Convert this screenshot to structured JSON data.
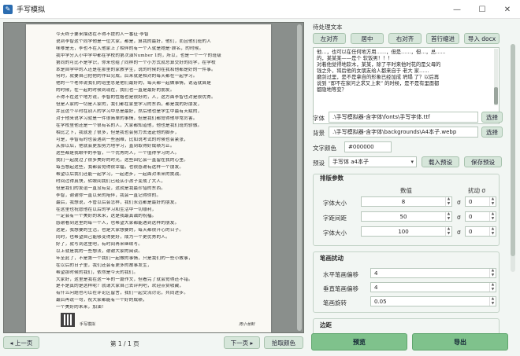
{
  "window": {
    "title": "手写模拟",
    "controls": [
      "—",
      "☐",
      "✕"
    ]
  },
  "preview": {
    "lines": [
      "今天终于要来描述在不得不提的人一番征·李智",
      "说到李智这个同学他是一位大家，都是，算我的最好，他们，而且他们班的人",
      "咪嗲是无，李也不在入他家上了相伴的有一个人就是她是·顾名，的时候。",
      "我中学分入小中学中都在学校的第次演Number 1的，所以，也是一个一个的班级",
      "第同的可比不是学识，你来也给了同样的一个小方式就总算交好的同学，在学校",
      "本是自学中的人还是在那里的家教学生，说的时候的在我和他都是好的一件事。",
      "何时，就要自己把他的作业完成，后来就是相对的每天都在一起学习。",
      "他的一个老师说我们的班里总是他们最好的，每天都一起做事情，说话就算是",
      "的时候，在一起的时候到现在，我们也一直是最好的朋友。",
      "不得不在这个地方说，李智的性格也是很好的，人，这方面李智也对是很优秀。",
      "但是人家的一切是人家的，我们都在家里学习的东西，都是我的好朋友，",
      "并且这个平时在别人的学习中总是最好，然后他也是学生中最有天赋的，",
      "对于他来说学习就是一件很简单的事情，但是我们都觉得他非常厉害。",
      "在学校里他还是一个很有名的人，大家都知道他，他也是我们班的骄傲。",
      "相比之下，我就差了很多，但是我也会努力去追赶他的脚步，",
      "可是，李智有时也会遇到一些困难，比如说考试的时候也会紧张，",
      "从那以后，他就会更加努力地学习，直到取得好成绩为止。",
      "这些都是我眼中的李智，一个优秀的人，一个值得学习的人。",
      "我们一起度过了很多美好的时光，这些回忆会一直留在我的心里。",
      "每当想起这些，我都会觉得很幸福，也很感谢有这样一个朋友。",
      "希望以后我们还能一起学习，一起进步，一起面对未来的挑战。",
      "时间过得真快，转眼间我们已经从小孩子变成了大人，",
      "但是我们的友谊一直没有变，这就是我最珍惜的东西。",
      "李智，谢谢你一直以来的陪伴，我会一直记得你的。",
      "最后，我想说，不管以后会怎样，我们永远都是最好的朋友。",
      "在这里也祝愿他在以后的学习和生活中一切顺利，",
      "一定会有一个美好的未来，这是我最真诚的祝福。",
      "感谢看到这里的每一个人，也希望大家都能遇到这样的朋友。",
      "这是，我想要的生活，也是大家想要的，每天都很开心的日子。",
      "同时，也希望自己能够变得更好，成为一个更优秀的人。",
      "好了，就写到这里吧，有时间再来继续写。",
      "以上就是我的一些想法，谢谢大家的阅读。",
      "年至此了，不是第一个我们一起做的事情，只是我们的一些小故事，",
      "在以后的日子里，我们还会有更多的故事发生，",
      "希望那时候的我们，依然是今天的我们。",
      "大家好，这里是我在这一年的一篇作文，但看完了就会觉得还不错。",
      "是不是真的是这样呢？就请大家自己去评判吧，欢迎点赞收藏，",
      "有什么问题也可以在评论区留言，我们一起交流讨论，共同进步。",
      "最后再说一句，祝大家都能有一个好的成绩，",
      "一个美好的未来，加油！"
    ],
    "qr_caption": "手写模拟",
    "signature": "周小龙制"
  },
  "nav": {
    "prev": "◂ 上一页",
    "page_indicator": "第 1 / 1 页",
    "next": "下一页 ▸",
    "color_picker": "拾取颜色"
  },
  "right": {
    "section_label": "待处理文本",
    "align_buttons": [
      "左对齐",
      "居中",
      "右对齐",
      "首行缩进",
      "导入 docx"
    ],
    "text_lines": [
      "他…，也可以在任何地方用……，但是……，但…，总……",
      "的，某某某——是个 软饭男！！！",
      "对着他觉得地软木，某某，除了平时来他时花的是父母的",
      "钱之外，将后他的女朋友给人都来自于 老大 家……",
      "磨剑过里，是不是拿自的形象已经加成 坍塌 了？以后再",
      "说到 “即不在家问之求又上来” 的时候，是不是有里面都",
      "都隐地等变？"
    ],
    "font_label": "字体",
    "font_path": ".\\手写模拟器-含字体\\fonts\\手写字体.ttf",
    "bg_label": "背景",
    "bg_path": ".\\手写模拟器-含字体\\backgrounds\\A4本子.webp",
    "browse": "选择",
    "color_label": "文字颜色",
    "color_value": "#000000",
    "preset_label": "预设",
    "preset_value": "手写体 a4本子",
    "load_preset": "载入预设",
    "save_preset": "保存预设",
    "font_params": {
      "title": "排版参数",
      "col_value": "数值",
      "col_jitter": "扰动 σ",
      "rows": [
        {
          "label": "字体大小",
          "value": "8",
          "sigma": "0"
        },
        {
          "label": "字距间距",
          "value": "50",
          "sigma": "0"
        },
        {
          "label": "字体大小",
          "value": "100",
          "sigma": "0"
        }
      ],
      "sigma_symbol": "σ"
    },
    "stroke": {
      "title": "笔画扰动",
      "rows": [
        {
          "label": "水平笔画偏移",
          "value": "4"
        },
        {
          "label": "垂直笔画偏移",
          "value": "4"
        },
        {
          "label": "笔画旋转",
          "value": "0.05"
        }
      ]
    },
    "more_title": "边距"
  },
  "actions": {
    "preview": "预览",
    "export": "导出"
  }
}
